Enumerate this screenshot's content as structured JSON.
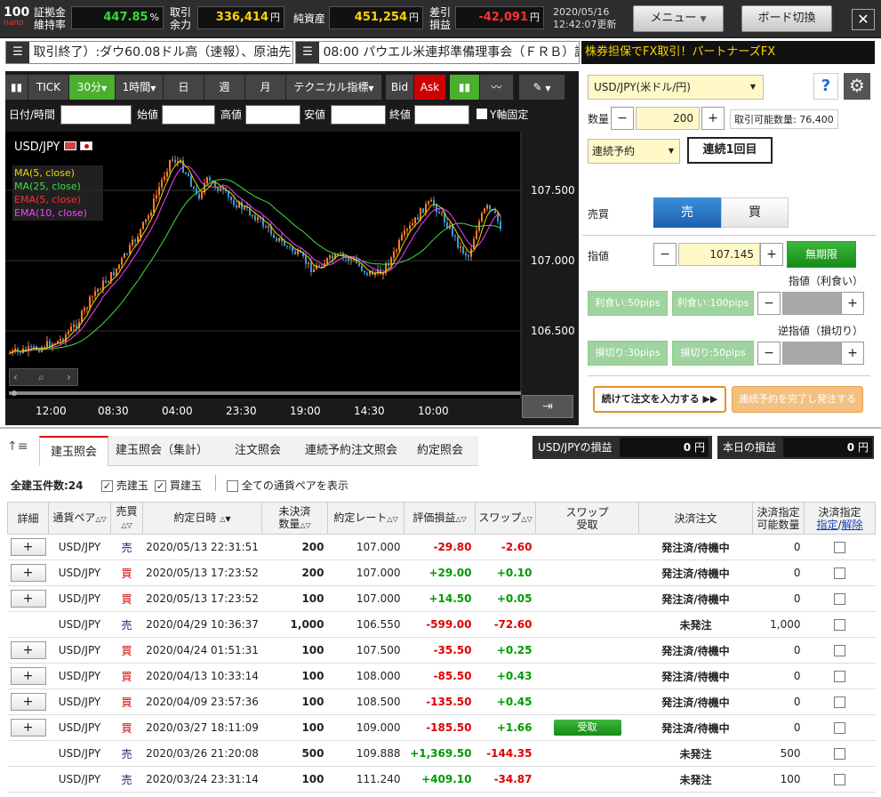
{
  "topbar": {
    "logo_top": "100",
    "logo_bottom": "nano",
    "margin_label": "証拠金\n維持率",
    "margin_value": "447.85",
    "margin_unit": "%",
    "available_label": "取引\n余力",
    "available_value": "336,414",
    "available_unit": "円",
    "net_label": "純資産",
    "net_value": "451,254",
    "net_unit": "円",
    "pl_label": "差引\n損益",
    "pl_value": "-42,091",
    "pl_unit": "円",
    "date": "2020/05/16",
    "time_updated": "12:42:07更新",
    "menu_label": "メニュー",
    "board_label": "ボード切換",
    "close_glyph": "✕",
    "colors": {
      "green": "#33dd33",
      "yellow": "#ffd400",
      "red": "#ff3030"
    }
  },
  "news": {
    "item1": "取引終了）:ダウ60.08ドル高（速報）、原油先",
    "item2": "08:00 パウエル米連邦準備理事会（ＦＲＢ）議",
    "ad": "株券担保でFX取引！パートナーズFX"
  },
  "chart": {
    "toolbar": {
      "tick": "TICK",
      "m30": "30分",
      "h1": "1時間",
      "day": "日",
      "week": "週",
      "month": "月",
      "tech": "テクニカル指標",
      "bid": "Bid",
      "ask": "Ask"
    },
    "fields": {
      "datetime": "日付/時間",
      "open": "始値",
      "high": "高値",
      "low": "安値",
      "close": "終値",
      "yfix": "Y軸固定"
    },
    "symbol": "USD/JPY",
    "legend": [
      {
        "label": "MA(5, close)",
        "color": "#e8d800"
      },
      {
        "label": "MA(25, close)",
        "color": "#44dd44"
      },
      {
        "label": "EMA(5, close)",
        "color": "#ff3030"
      },
      {
        "label": "EMA(10, close)",
        "color": "#ff40ff"
      }
    ],
    "yticks": [
      "107.500",
      "107.000",
      "106.500"
    ],
    "xticks": [
      "12:00",
      "08:30",
      "04:00",
      "23:30",
      "19:00",
      "14:30",
      "10:00"
    ]
  },
  "order": {
    "pair": "USD/JPY(米ドル/円)",
    "qty_label": "数量",
    "qty_value": "200",
    "tradable": "取引可能数量: 76,400",
    "mode": "連続予約",
    "sequence": "連続1回目",
    "side_label": "売買",
    "sell": "売",
    "buy": "買",
    "price_label": "指値",
    "price_value": "107.145",
    "unlimited": "無期限",
    "tp_label": "指値（利食い）",
    "tp1": "利食い:50pips",
    "tp2": "利食い:100pips",
    "sl_label": "逆指値（損切り）",
    "sl1": "損切り:30pips",
    "sl2": "損切り:50pips",
    "continue_btn": "続けて注文を入力する ▶▶",
    "complete_btn": "連続予約を完了し発注する",
    "minus": "−",
    "plus": "+",
    "help": "?"
  },
  "tabs": [
    "建玉照会",
    "建玉照会（集計）",
    "注文照会",
    "連続予約注文照会",
    "約定照会"
  ],
  "pl_summary": {
    "pair_label": "USD/JPYの損益",
    "pair_value": "0",
    "today_label": "本日の損益",
    "today_value": "0",
    "unit": "円"
  },
  "filters": {
    "count": "全建玉件数:24",
    "sell": "売建玉",
    "buy": "買建玉",
    "all": "全ての通貨ペアを表示"
  },
  "table": {
    "headers": [
      "詳細",
      "通貨ペア",
      "売買",
      "約定日時",
      "未決済\n数量",
      "約定レート",
      "評価損益",
      "スワップ",
      "スワップ\n受取",
      "決済注文",
      "決済指定\n可能数量",
      "決済指定"
    ],
    "header_link1": "指定",
    "header_link2": "解除",
    "swap_receive": "受取",
    "rows": [
      {
        "plus": "+",
        "pair": "USD/JPY",
        "side": "売",
        "date": "2020/05/13 22:31:51",
        "qty": "200",
        "rate": "107.000",
        "pl": "-29.80",
        "swap": "-2.60",
        "recv": "",
        "status": "発注済/待機中",
        "avail": "0"
      },
      {
        "plus": "+",
        "pair": "USD/JPY",
        "side": "買",
        "date": "2020/05/13 17:23:52",
        "qty": "200",
        "rate": "107.000",
        "pl": "+29.00",
        "swap": "+0.10",
        "recv": "",
        "status": "発注済/待機中",
        "avail": "0"
      },
      {
        "plus": "+",
        "pair": "USD/JPY",
        "side": "買",
        "date": "2020/05/13 17:23:52",
        "qty": "100",
        "rate": "107.000",
        "pl": "+14.50",
        "swap": "+0.05",
        "recv": "",
        "status": "発注済/待機中",
        "avail": "0"
      },
      {
        "plus": "",
        "pair": "USD/JPY",
        "side": "売",
        "date": "2020/04/29 10:36:37",
        "qty": "1,000",
        "rate": "106.550",
        "pl": "-599.00",
        "swap": "-72.60",
        "recv": "",
        "status": "未発注",
        "avail": "1,000"
      },
      {
        "plus": "+",
        "pair": "USD/JPY",
        "side": "買",
        "date": "2020/04/24 01:51:31",
        "qty": "100",
        "rate": "107.500",
        "pl": "-35.50",
        "swap": "+0.25",
        "recv": "",
        "status": "発注済/待機中",
        "avail": "0"
      },
      {
        "plus": "+",
        "pair": "USD/JPY",
        "side": "買",
        "date": "2020/04/13 10:33:14",
        "qty": "100",
        "rate": "108.000",
        "pl": "-85.50",
        "swap": "+0.43",
        "recv": "",
        "status": "発注済/待機中",
        "avail": "0"
      },
      {
        "plus": "+",
        "pair": "USD/JPY",
        "side": "買",
        "date": "2020/04/09 23:57:36",
        "qty": "100",
        "rate": "108.500",
        "pl": "-135.50",
        "swap": "+0.45",
        "recv": "",
        "status": "発注済/待機中",
        "avail": "0"
      },
      {
        "plus": "+",
        "pair": "USD/JPY",
        "side": "買",
        "date": "2020/03/27 18:11:09",
        "qty": "100",
        "rate": "109.000",
        "pl": "-185.50",
        "swap": "+1.66",
        "recv": "受取",
        "status": "発注済/待機中",
        "avail": "0"
      },
      {
        "plus": "",
        "pair": "USD/JPY",
        "side": "売",
        "date": "2020/03/26 21:20:08",
        "qty": "500",
        "rate": "109.888",
        "pl": "+1,369.50",
        "swap": "-144.35",
        "recv": "",
        "status": "未発注",
        "avail": "500"
      },
      {
        "plus": "",
        "pair": "USD/JPY",
        "side": "売",
        "date": "2020/03/24 23:31:14",
        "qty": "100",
        "rate": "111.240",
        "pl": "+409.10",
        "swap": "-34.87",
        "recv": "",
        "status": "未発注",
        "avail": "100"
      }
    ]
  }
}
